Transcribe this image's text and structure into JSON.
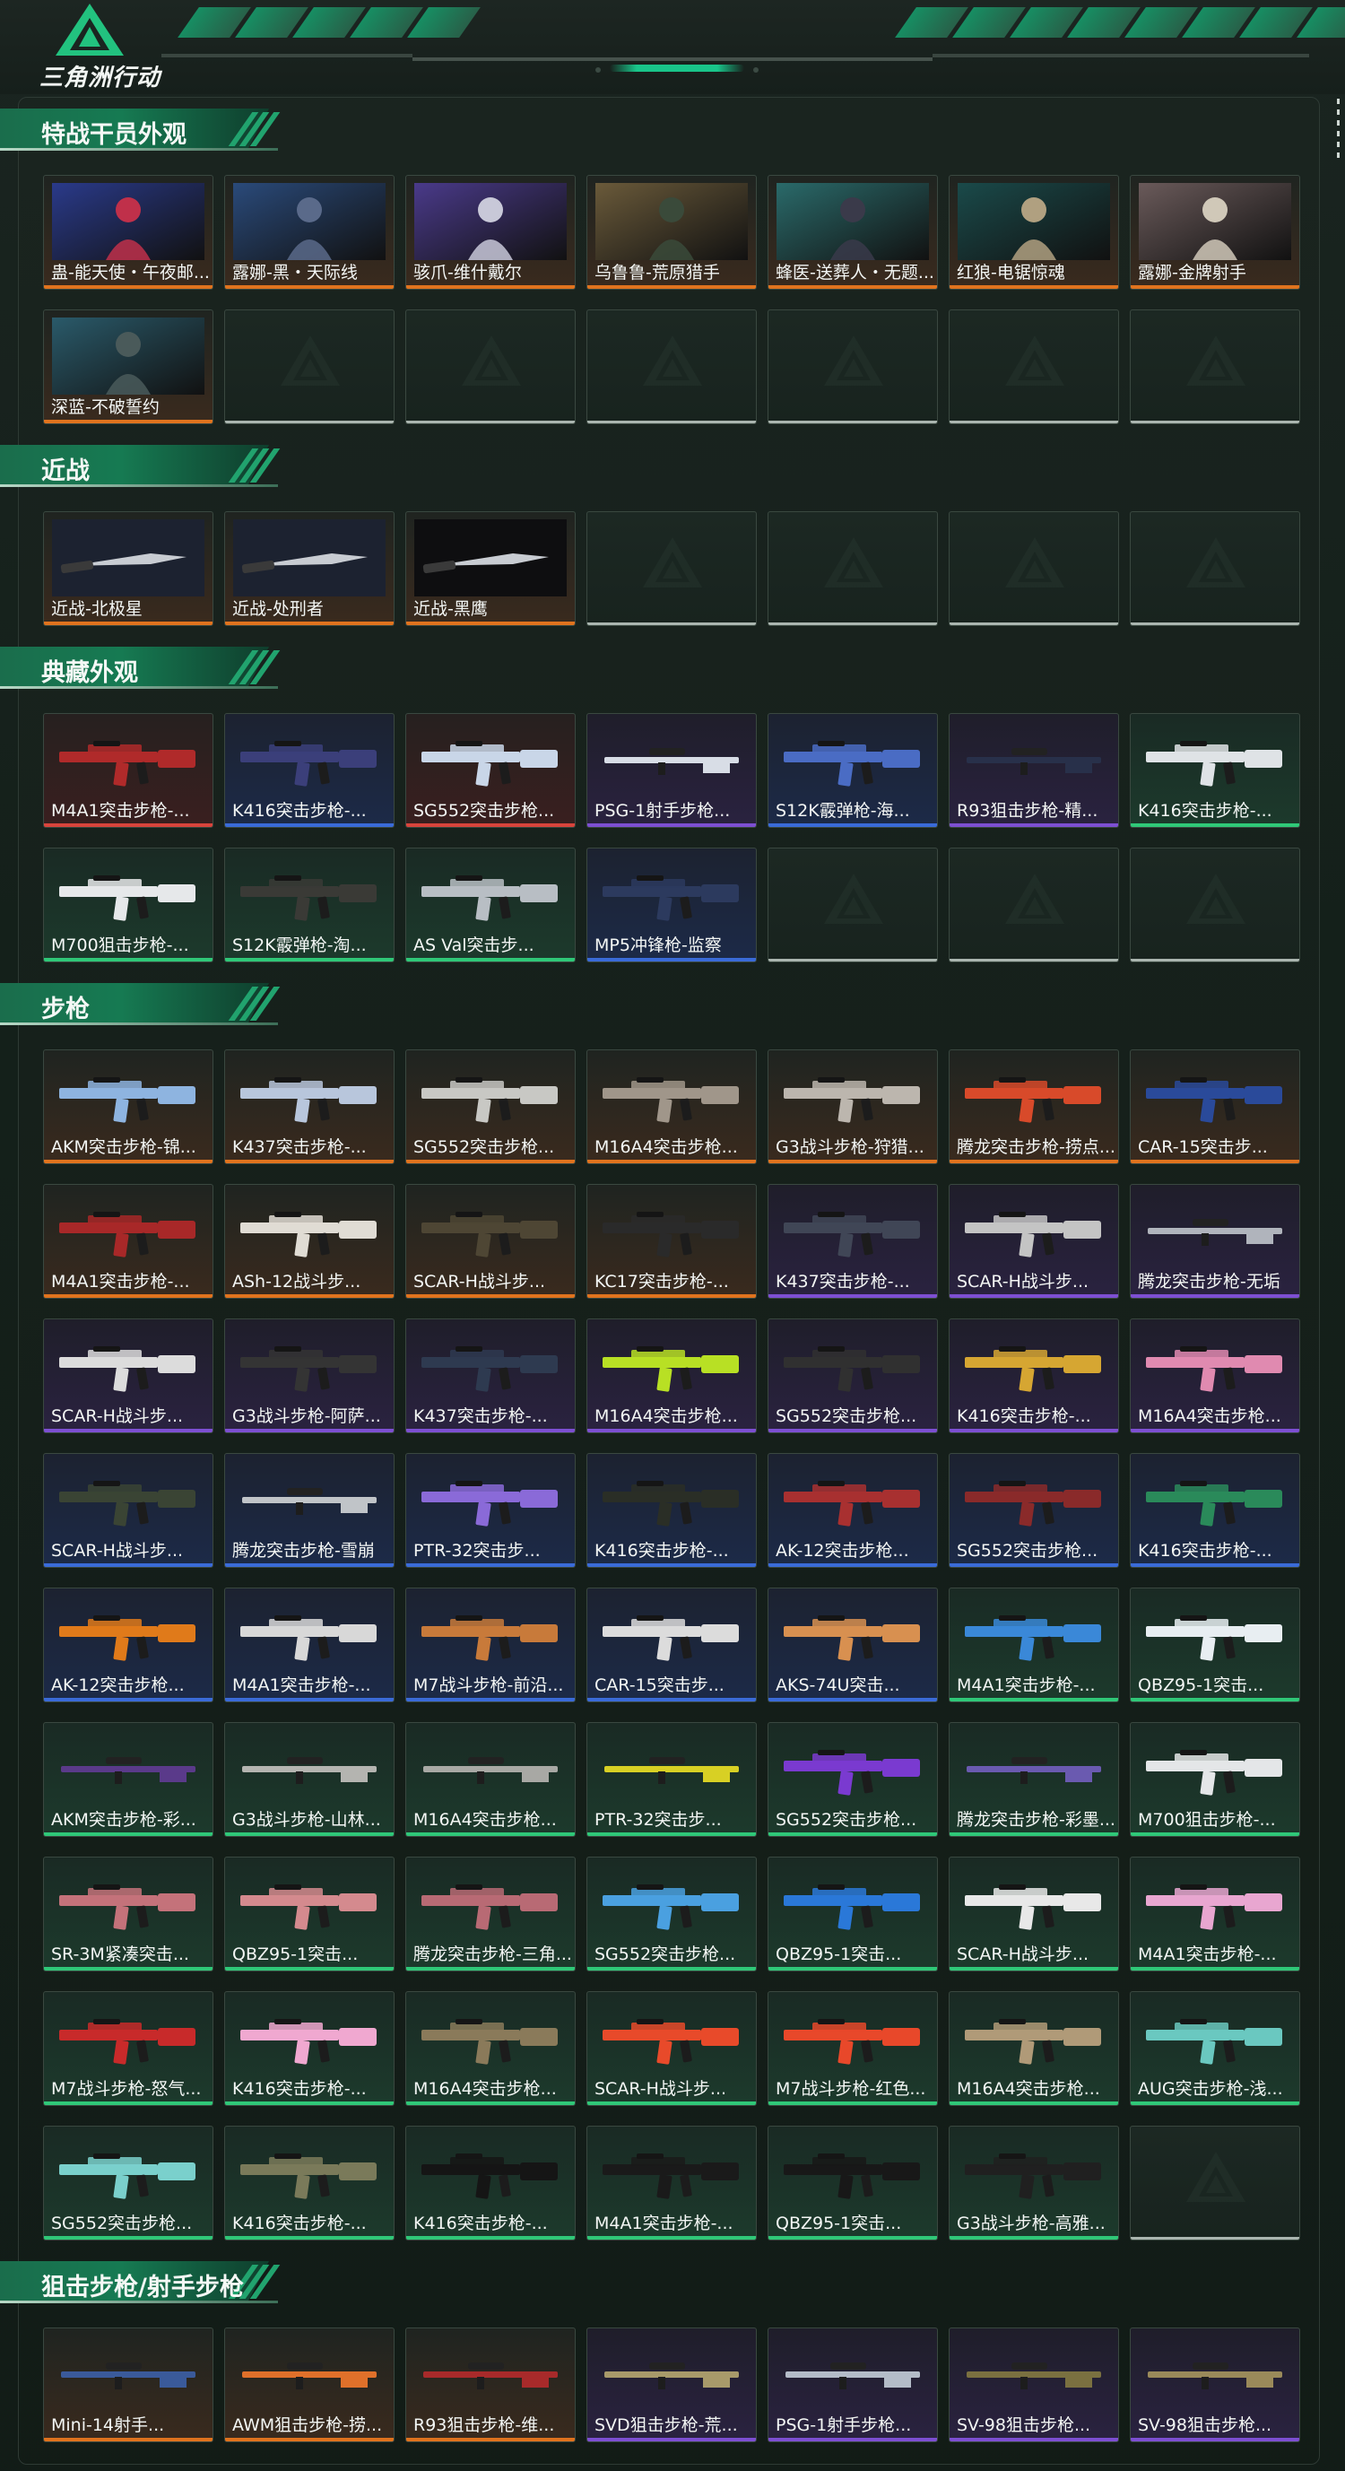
{
  "app": {
    "logo_text": "三角洲行动"
  },
  "sections": [
    {
      "id": "operator",
      "title": "特战干员外观",
      "items": [
        {
          "label": "蛊-能天使・午夜邮...",
          "rarity": "orange",
          "art": "operator"
        },
        {
          "label": "露娜-黑・天际线",
          "rarity": "orange",
          "art": "operator"
        },
        {
          "label": "骇爪-维什戴尔",
          "rarity": "orange",
          "art": "operator"
        },
        {
          "label": "乌鲁鲁-荒原猎手",
          "rarity": "orange",
          "art": "operator"
        },
        {
          "label": "蜂医-送葬人・无题...",
          "rarity": "orange",
          "art": "operator"
        },
        {
          "label": "红狼-电锯惊魂",
          "rarity": "orange",
          "art": "operator"
        },
        {
          "label": "露娜-金牌射手",
          "rarity": "orange",
          "art": "operator"
        },
        {
          "label": "深蓝-不破誓约",
          "rarity": "orange",
          "art": "operator"
        },
        {
          "label": "",
          "rarity": "empty"
        },
        {
          "label": "",
          "rarity": "empty"
        },
        {
          "label": "",
          "rarity": "empty"
        },
        {
          "label": "",
          "rarity": "empty"
        },
        {
          "label": "",
          "rarity": "empty"
        },
        {
          "label": "",
          "rarity": "empty"
        }
      ]
    },
    {
      "id": "melee",
      "title": "近战",
      "items": [
        {
          "label": "近战-北极星",
          "rarity": "orange",
          "art": "melee"
        },
        {
          "label": "近战-处刑者",
          "rarity": "orange",
          "art": "melee"
        },
        {
          "label": "近战-黑鹰",
          "rarity": "orange",
          "art": "melee"
        },
        {
          "label": "",
          "rarity": "empty"
        },
        {
          "label": "",
          "rarity": "empty"
        },
        {
          "label": "",
          "rarity": "empty"
        },
        {
          "label": "",
          "rarity": "empty"
        }
      ]
    },
    {
      "id": "collection",
      "title": "典藏外观",
      "items": [
        {
          "label": "M4A1突击步枪-...",
          "rarity": "red",
          "art": "rifle",
          "gun": "#b02a2a"
        },
        {
          "label": "K416突击步枪-...",
          "rarity": "blue",
          "art": "rifle",
          "gun": "#3b3f7a"
        },
        {
          "label": "SG552突击步枪...",
          "rarity": "red",
          "art": "rifle",
          "gun": "#c9d6e8"
        },
        {
          "label": "PSG-1射手步枪...",
          "rarity": "purple",
          "art": "sniper",
          "gun": "#d8dde6"
        },
        {
          "label": "S12K霰弹枪-海...",
          "rarity": "blue",
          "art": "rifle",
          "gun": "#4a6cc4"
        },
        {
          "label": "R93狙击步枪-精...",
          "rarity": "purple",
          "art": "sniper",
          "gun": "#28304a"
        },
        {
          "label": "K416突击步枪-...",
          "rarity": "green",
          "art": "rifle",
          "gun": "#dfe3e6"
        },
        {
          "label": "M700狙击步枪-...",
          "rarity": "green",
          "art": "rifle",
          "gun": "#e6e8ea"
        },
        {
          "label": "S12K霰弹枪-淘...",
          "rarity": "green",
          "art": "rifle",
          "gun": "#3a3a36"
        },
        {
          "label": "AS Val突击步...",
          "rarity": "green",
          "art": "rifle",
          "gun": "#b8bec4"
        },
        {
          "label": "MP5冲锋枪-监察",
          "rarity": "blue",
          "art": "rifle",
          "gun": "#2c3a5e"
        },
        {
          "label": "",
          "rarity": "empty"
        },
        {
          "label": "",
          "rarity": "empty"
        },
        {
          "label": "",
          "rarity": "empty"
        }
      ]
    },
    {
      "id": "rifle",
      "title": "步枪",
      "items": [
        {
          "label": "AKM突击步枪-锦...",
          "rarity": "orange",
          "art": "rifle",
          "gun": "#8eb4e0"
        },
        {
          "label": "K437突击步枪-...",
          "rarity": "orange",
          "art": "rifle",
          "gun": "#b8c6dc"
        },
        {
          "label": "SG552突击步枪...",
          "rarity": "orange",
          "art": "rifle",
          "gun": "#c8c8c4"
        },
        {
          "label": "M16A4突击步枪...",
          "rarity": "orange",
          "art": "rifle",
          "gun": "#a0968a"
        },
        {
          "label": "G3战斗步枪-狩猎...",
          "rarity": "orange",
          "art": "rifle",
          "gun": "#bcb6ae"
        },
        {
          "label": "腾龙突击步枪-捞点...",
          "rarity": "orange",
          "art": "rifle",
          "gun": "#d84a2a"
        },
        {
          "label": "CAR-15突击步...",
          "rarity": "orange",
          "art": "rifle",
          "gun": "#2a4a9a"
        },
        {
          "label": "M4A1突击步枪-...",
          "rarity": "orange",
          "art": "rifle",
          "gun": "#a82828"
        },
        {
          "label": "ASh-12战斗步...",
          "rarity": "orange",
          "art": "rifle",
          "gun": "#e0dcd4"
        },
        {
          "label": "SCAR-H战斗步...",
          "rarity": "orange",
          "art": "rifle",
          "gun": "#4e4634"
        },
        {
          "label": "KC17突击步枪-...",
          "rarity": "orange",
          "art": "rifle",
          "gun": "#2a2a2a"
        },
        {
          "label": "K437突击步枪-...",
          "rarity": "purple",
          "art": "rifle",
          "gun": "#404656"
        },
        {
          "label": "SCAR-H战斗步...",
          "rarity": "purple",
          "art": "rifle",
          "gun": "#c4c4c4"
        },
        {
          "label": "腾龙突击步枪-无垢",
          "rarity": "purple",
          "art": "sniper",
          "gun": "#b0b4bc"
        },
        {
          "label": "SCAR-H战斗步...",
          "rarity": "purple",
          "art": "rifle",
          "gun": "#dcdcdc"
        },
        {
          "label": "G3战斗步枪-阿萨...",
          "rarity": "purple",
          "art": "rifle",
          "gun": "#343434"
        },
        {
          "label": "K437突击步枪-...",
          "rarity": "purple",
          "art": "rifle",
          "gun": "#2e3a50"
        },
        {
          "label": "M16A4突击步枪...",
          "rarity": "purple",
          "art": "rifle",
          "gun": "#b8e024"
        },
        {
          "label": "SG552突击步枪...",
          "rarity": "purple",
          "art": "rifle",
          "gun": "#303030"
        },
        {
          "label": "K416突击步枪-...",
          "rarity": "purple",
          "art": "rifle",
          "gun": "#d6a632"
        },
        {
          "label": "M16A4突击步枪...",
          "rarity": "purple",
          "art": "rifle",
          "gun": "#e08ab0"
        },
        {
          "label": "SCAR-H战斗步...",
          "rarity": "blue",
          "art": "rifle",
          "gun": "#3a4434"
        },
        {
          "label": "腾龙突击步枪-雪崩",
          "rarity": "blue",
          "art": "sniper",
          "gun": "#c0c4c8"
        },
        {
          "label": "PTR-32突击步...",
          "rarity": "blue",
          "art": "rifle",
          "gun": "#8a6ad8"
        },
        {
          "label": "K416突击步枪-...",
          "rarity": "blue",
          "art": "rifle",
          "gun": "#2a2e26"
        },
        {
          "label": "AK-12突击步枪...",
          "rarity": "blue",
          "art": "rifle",
          "gun": "#a83030"
        },
        {
          "label": "SG552突击步枪...",
          "rarity": "blue",
          "art": "rifle",
          "gun": "#8a2a2a"
        },
        {
          "label": "K416突击步枪-...",
          "rarity": "blue",
          "art": "rifle",
          "gun": "#2a8a5a"
        },
        {
          "label": "AK-12突击步枪...",
          "rarity": "blue",
          "art": "rifle",
          "gun": "#e07a1a"
        },
        {
          "label": "M4A1突击步枪-...",
          "rarity": "blue",
          "art": "rifle",
          "gun": "#d8d8d8"
        },
        {
          "label": "M7战斗步枪-前沿...",
          "rarity": "blue",
          "art": "rifle",
          "gun": "#c87a3a"
        },
        {
          "label": "CAR-15突击步...",
          "rarity": "blue",
          "art": "rifle",
          "gun": "#dcdcdc"
        },
        {
          "label": "AKS-74U突击...",
          "rarity": "blue",
          "art": "rifle",
          "gun": "#d89050"
        },
        {
          "label": "M4A1突击步枪-...",
          "rarity": "green",
          "art": "rifle",
          "gun": "#3a88d8"
        },
        {
          "label": "QBZ95-1突击...",
          "rarity": "green",
          "art": "rifle",
          "gun": "#e8eef2"
        },
        {
          "label": "AKM突击步枪-彩...",
          "rarity": "green",
          "art": "sniper",
          "gun": "#5a3a8a"
        },
        {
          "label": "G3战斗步枪-山林...",
          "rarity": "green",
          "art": "sniper",
          "gun": "#b4b4b0"
        },
        {
          "label": "M16A4突击步枪...",
          "rarity": "green",
          "art": "sniper",
          "gun": "#a8a8a4"
        },
        {
          "label": "PTR-32突击步...",
          "rarity": "green",
          "art": "sniper",
          "gun": "#d8d024"
        },
        {
          "label": "SG552突击步枪...",
          "rarity": "green",
          "art": "rifle",
          "gun": "#7a3ad0"
        },
        {
          "label": "腾龙突击步枪-彩墨...",
          "rarity": "green",
          "art": "sniper",
          "gun": "#6a5ab0"
        },
        {
          "label": "M700狙击步枪-...",
          "rarity": "green",
          "art": "rifle",
          "gun": "#e4e6e8"
        },
        {
          "label": "SR-3M紧凑突击...",
          "rarity": "green",
          "art": "rifle",
          "gun": "#c4727a"
        },
        {
          "label": "QBZ95-1突击...",
          "rarity": "green",
          "art": "rifle",
          "gun": "#d48a8e"
        },
        {
          "label": "腾龙突击步枪-三角...",
          "rarity": "green",
          "art": "rifle",
          "gun": "#b86a74"
        },
        {
          "label": "SG552突击步枪...",
          "rarity": "green",
          "art": "rifle",
          "gun": "#4aa0e0"
        },
        {
          "label": "QBZ95-1突击...",
          "rarity": "green",
          "art": "rifle",
          "gun": "#2a78d8"
        },
        {
          "label": "SCAR-H战斗步...",
          "rarity": "green",
          "art": "rifle",
          "gun": "#e8e8e8"
        },
        {
          "label": "M4A1突击步枪-...",
          "rarity": "green",
          "art": "rifle",
          "gun": "#e8a6d0"
        },
        {
          "label": "M7战斗步枪-怒气...",
          "rarity": "green",
          "art": "rifle",
          "gun": "#c82a2a"
        },
        {
          "label": "K416突击步枪-...",
          "rarity": "green",
          "art": "rifle",
          "gun": "#f0a8d0"
        },
        {
          "label": "M16A4突击步枪...",
          "rarity": "green",
          "art": "rifle",
          "gun": "#8a7a5a"
        },
        {
          "label": "SCAR-H战斗步...",
          "rarity": "green",
          "art": "rifle",
          "gun": "#e84a2a"
        },
        {
          "label": "M7战斗步枪-红色...",
          "rarity": "green",
          "art": "rifle",
          "gun": "#e8482a"
        },
        {
          "label": "M16A4突击步枪...",
          "rarity": "green",
          "art": "rifle",
          "gun": "#b09a78"
        },
        {
          "label": "AUG突击步枪-浅...",
          "rarity": "green",
          "art": "rifle",
          "gun": "#6ac8c0"
        },
        {
          "label": "SG552突击步枪...",
          "rarity": "green",
          "art": "rifle",
          "gun": "#7ad0cc"
        },
        {
          "label": "K416突击步枪-...",
          "rarity": "green",
          "art": "rifle",
          "gun": "#7a7a5a"
        },
        {
          "label": "K416突击步枪-...",
          "rarity": "green",
          "art": "rifle",
          "gun": "#151515"
        },
        {
          "label": "M4A1突击步枪-...",
          "rarity": "green",
          "art": "rifle",
          "gun": "#1a1a1a"
        },
        {
          "label": "QBZ95-1突击...",
          "rarity": "green",
          "art": "rifle",
          "gun": "#181818"
        },
        {
          "label": "G3战斗步枪-高雅...",
          "rarity": "green",
          "art": "rifle",
          "gun": "#202020"
        },
        {
          "label": "",
          "rarity": "empty"
        }
      ]
    },
    {
      "id": "sniper",
      "title": "狙击步枪/射手步枪",
      "items": [
        {
          "label": "Mini-14射手...",
          "rarity": "orange",
          "art": "sniper",
          "gun": "#3a5a9a"
        },
        {
          "label": "AWM狙击步枪-捞...",
          "rarity": "orange",
          "art": "sniper",
          "gun": "#e0702a"
        },
        {
          "label": "R93狙击步枪-维...",
          "rarity": "orange",
          "art": "sniper",
          "gun": "#a82a2a"
        },
        {
          "label": "SVD狙击步枪-荒...",
          "rarity": "purple",
          "art": "sniper",
          "gun": "#a89a6a"
        },
        {
          "label": "PSG-1射手步枪...",
          "rarity": "purple",
          "art": "sniper",
          "gun": "#b4bcc8"
        },
        {
          "label": "SV-98狙击步枪...",
          "rarity": "purple",
          "art": "sniper",
          "gun": "#7a7040"
        },
        {
          "label": "SV-98狙击步枪...",
          "rarity": "purple",
          "art": "sniper",
          "gun": "#9a8a5a"
        }
      ]
    }
  ]
}
